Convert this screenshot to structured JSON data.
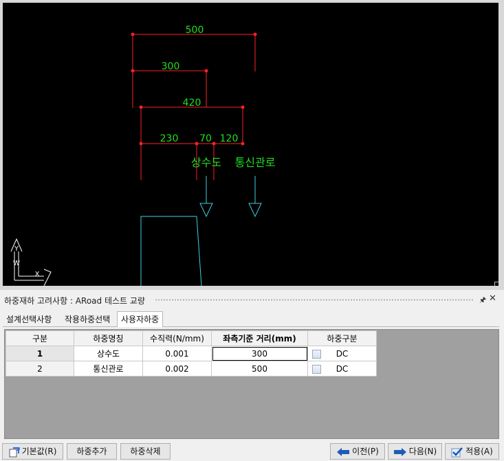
{
  "cad": {
    "dims": [
      {
        "label": "500"
      },
      {
        "label": "300"
      },
      {
        "label": "420"
      },
      {
        "label": "230"
      },
      {
        "label": "70"
      },
      {
        "label": "120"
      }
    ],
    "loads": [
      "상수도",
      "통신관로"
    ],
    "axis": {
      "y": "Y",
      "x": "X",
      "w": "W"
    }
  },
  "panel": {
    "title": "하중재하 고려사항 : ARoad 테스트 교량",
    "pin": "ᵖ",
    "close": "✕"
  },
  "tabs": [
    {
      "label": "설계선택사항"
    },
    {
      "label": "작용하중선택"
    },
    {
      "label": "사용자하중"
    }
  ],
  "grid": {
    "headers": [
      "구분",
      "하중명칭",
      "수직력(N/mm)",
      "좌측기준 거리(mm)",
      "하중구분"
    ],
    "rows": [
      {
        "no": "1",
        "name": "상수도",
        "force": "0.001",
        "dist": "300",
        "type": "DC"
      },
      {
        "no": "2",
        "name": "통신관로",
        "force": "0.002",
        "dist": "500",
        "type": "DC"
      }
    ]
  },
  "buttons": {
    "default": "기본값(R)",
    "add": "하중추가",
    "delete": "하중삭제",
    "prev": "이전(P)",
    "next": "다음(N)",
    "apply": "적용(A)"
  },
  "colors": {
    "dimension": "#ff2020",
    "label": "#20e020",
    "structure": "#3fd0e0"
  }
}
